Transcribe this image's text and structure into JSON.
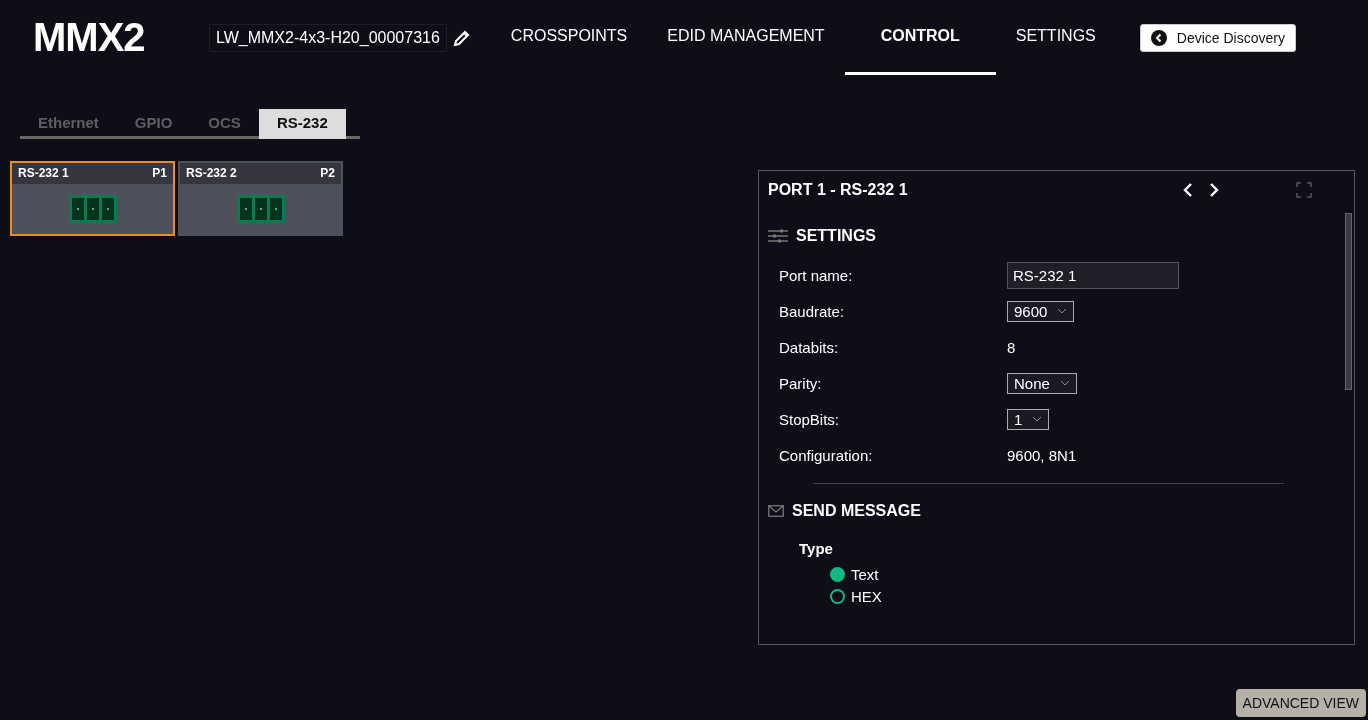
{
  "logo": "MMX2",
  "device_name": "LW_MMX2-4x3-H20_00007316",
  "nav": [
    {
      "label": "CROSSPOINTS",
      "selected": false
    },
    {
      "label": "EDID MANAGEMENT",
      "selected": false
    },
    {
      "label": "CONTROL",
      "selected": true
    },
    {
      "label": "SETTINGS",
      "selected": false
    }
  ],
  "discovery_button": "Device Discovery",
  "tabs": [
    {
      "label": "Ethernet",
      "selected": false
    },
    {
      "label": "GPIO",
      "selected": false
    },
    {
      "label": "OCS",
      "selected": false
    },
    {
      "label": "RS-232",
      "selected": true
    }
  ],
  "ports": [
    {
      "name": "RS-232 1",
      "port": "P1",
      "selected": true
    },
    {
      "name": "RS-232 2",
      "port": "P2",
      "selected": false
    }
  ],
  "panel": {
    "title": "PORT 1 - RS-232 1",
    "settings": {
      "heading": "SETTINGS",
      "rows": [
        {
          "label": "Port name:",
          "kind": "input",
          "value": "RS-232 1"
        },
        {
          "label": "Baudrate:",
          "kind": "select",
          "value": "9600"
        },
        {
          "label": "Databits:",
          "kind": "text",
          "value": "8"
        },
        {
          "label": "Parity:",
          "kind": "select",
          "value": "None"
        },
        {
          "label": "StopBits:",
          "kind": "select",
          "value": "1"
        },
        {
          "label": "Configuration:",
          "kind": "text",
          "value": "9600, 8N1"
        }
      ]
    },
    "send_message": {
      "heading": "SEND MESSAGE",
      "type_label": "Type",
      "options": [
        {
          "label": "Text",
          "selected": true
        },
        {
          "label": "HEX",
          "selected": false
        }
      ]
    }
  },
  "advanced_button": "ADVANCED VIEW"
}
